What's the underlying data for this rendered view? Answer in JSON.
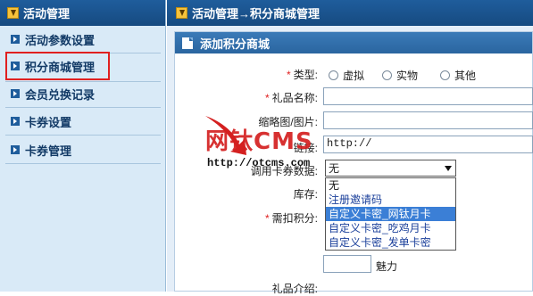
{
  "sidebar": {
    "header": "活动管理",
    "items": [
      {
        "label": "活动参数设置"
      },
      {
        "label": "积分商城管理"
      },
      {
        "label": "会员兑换记录"
      },
      {
        "label": "卡券设置"
      },
      {
        "label": "卡券管理"
      }
    ]
  },
  "main": {
    "breadcrumb": "活动管理→积分商城管理",
    "card_title": "添加积分商城",
    "form": {
      "type_label": "类型:",
      "type_options": [
        "虚拟",
        "实物",
        "其他"
      ],
      "name_label": "礼品名称:",
      "thumb_label": "缩略图/图片:",
      "link_label": "链接:",
      "link_value": "http://",
      "card_data_label": "调用卡券数据:",
      "card_data_selected": "无",
      "stock_label": "库存:",
      "points_label": "需扣积分:",
      "charm_label": "魅力",
      "intro_label": "礼品介绍:"
    },
    "dropdown_options": [
      "无",
      "注册邀请码",
      "自定义卡密_网钛月卡",
      "自定义卡密_吃鸡月卡",
      "自定义卡密_发单卡密"
    ],
    "dropdown_selected_index": 2
  },
  "watermark": {
    "brand": "网钛CMS",
    "url": "http://otcms.com"
  },
  "colors": {
    "header_bg": "#1f5d9c",
    "sidebar_bg": "#d9eaf7",
    "highlight": "#e02020",
    "option_selected": "#3b7fd6"
  }
}
